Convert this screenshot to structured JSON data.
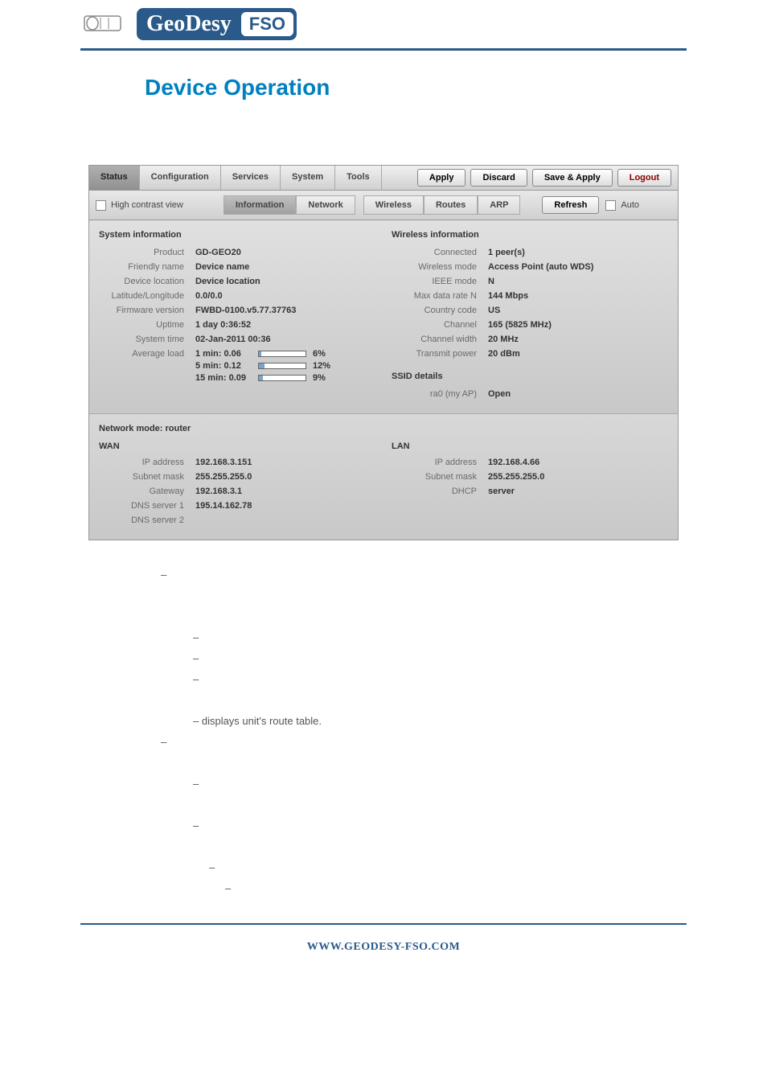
{
  "brand": {
    "name": "GeoDesy",
    "suffix": "FSO"
  },
  "page_title": "Device Operation",
  "top_buttons": {
    "apply": "Apply",
    "discard": "Discard",
    "save_apply": "Save & Apply",
    "logout": "Logout"
  },
  "main_tabs": {
    "status": "Status",
    "configuration": "Configuration",
    "services": "Services",
    "system": "System",
    "tools": "Tools"
  },
  "contrast_label": "High contrast view",
  "sub_tabs_left": {
    "information": "Information",
    "network": "Network"
  },
  "sub_tabs_right": {
    "wireless": "Wireless",
    "routes": "Routes",
    "arp": "ARP"
  },
  "refresh": {
    "button": "Refresh",
    "auto": "Auto"
  },
  "system_info": {
    "title": "System information",
    "rows": {
      "product": {
        "label": "Product",
        "value": "GD-GEO20"
      },
      "friendly_name": {
        "label": "Friendly name",
        "value": "Device name"
      },
      "device_location": {
        "label": "Device location",
        "value": "Device location"
      },
      "lat_lon": {
        "label": "Latitude/Longitude",
        "value": "0.0/0.0"
      },
      "firmware": {
        "label": "Firmware version",
        "value": "FWBD-0100.v5.77.37763"
      },
      "uptime": {
        "label": "Uptime",
        "value": "1 day 0:36:52"
      },
      "system_time": {
        "label": "System time",
        "value": "02-Jan-2011 00:36"
      },
      "avg_load": {
        "label": "Average load"
      }
    },
    "load": [
      {
        "label": "1 min: 0.06",
        "pct": 6
      },
      {
        "label": "5 min: 0.12",
        "pct": 12
      },
      {
        "label": "15 min: 0.09",
        "pct": 9
      }
    ]
  },
  "wireless_info": {
    "title": "Wireless information",
    "rows": {
      "connected": {
        "label": "Connected",
        "value": "1 peer(s)"
      },
      "wireless_mode": {
        "label": "Wireless mode",
        "value": "Access Point (auto WDS)"
      },
      "ieee_mode": {
        "label": "IEEE mode",
        "value": "N"
      },
      "max_rate": {
        "label": "Max data rate N",
        "value": "144 Mbps"
      },
      "country": {
        "label": "Country code",
        "value": "US"
      },
      "channel": {
        "label": "Channel",
        "value": "165 (5825 MHz)"
      },
      "channel_width": {
        "label": "Channel width",
        "value": "20 MHz"
      },
      "tx_power": {
        "label": "Transmit power",
        "value": "20 dBm"
      }
    }
  },
  "ssid": {
    "title": "SSID details",
    "row": {
      "label": "ra0 (my AP)",
      "value": "Open"
    }
  },
  "network": {
    "mode_label": "Network mode: router",
    "wan": {
      "title": "WAN",
      "rows": {
        "ip": {
          "label": "IP address",
          "value": "192.168.3.151"
        },
        "subnet": {
          "label": "Subnet mask",
          "value": "255.255.255.0"
        },
        "gateway": {
          "label": "Gateway",
          "value": "192.168.3.1"
        },
        "dns1": {
          "label": "DNS server 1",
          "value": "195.14.162.78"
        },
        "dns2": {
          "label": "DNS server 2",
          "value": ""
        }
      }
    },
    "lan": {
      "title": "LAN",
      "rows": {
        "ip": {
          "label": "IP address",
          "value": "192.168.4.66"
        },
        "subnet": {
          "label": "Subnet mask",
          "value": "255.255.255.0"
        },
        "dhcp": {
          "label": "DHCP",
          "value": "server"
        }
      }
    }
  },
  "below_text": "– displays unit's route table.",
  "footer": "WWW.GEODESY-FSO.COM"
}
